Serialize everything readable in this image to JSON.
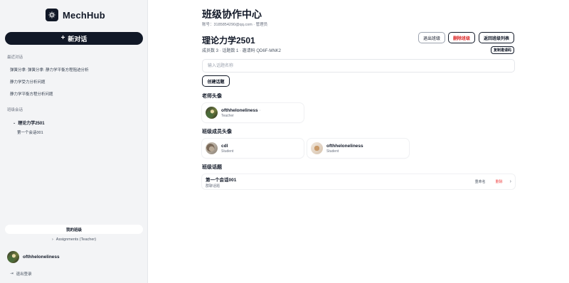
{
  "app": {
    "name": "MechHub"
  },
  "sidebar": {
    "new_chat_label": "新对话",
    "recent_label": "最近对话",
    "recent_items": [
      {
        "label": "弹簧分拿: 弹簧分拿: 静力学平衡方程阻迹分析"
      },
      {
        "label": "静力学受力分析问题"
      },
      {
        "label": "静力学平衡方程分析问题"
      }
    ],
    "class_session_label": "班级会话",
    "class_tree": {
      "class_name": "理论力学2501",
      "sessions": [
        {
          "label": "第一个会话001"
        }
      ]
    },
    "my_class_label": "我的班级",
    "assignments_label": "Assignments (Teacher)",
    "user": {
      "name": "ofthheloneliness"
    },
    "logout_label": "退出登录"
  },
  "main": {
    "page_title": "班级协作中心",
    "account_info": "账号：3185854290@qq.com · 管理员",
    "class": {
      "name": "理论力学2501",
      "meta": "成员数 3 · 话题数 1 · 邀请码 QD6F-MNK2"
    },
    "buttons": {
      "exit": "退出班级",
      "delete": "删除班级",
      "back": "返回班级列表",
      "copy_invite": "复制邀请码",
      "create_topic": "创建话题"
    },
    "topic_input_placeholder": "输入话题名称",
    "teacher_section": "老师头像",
    "teacher": {
      "name": "ofthheloneliness",
      "dot": "·",
      "role": "Teacher"
    },
    "members_section": "班级成员头像",
    "members": [
      {
        "name": "cdl",
        "role": "Student"
      },
      {
        "name": "ofthheloneliness",
        "role": "Student"
      }
    ],
    "topics_section": "班级话题",
    "topics": [
      {
        "name": "第一个会话001",
        "sub": "群聊话题",
        "rename": "重命名",
        "delete": "删除"
      }
    ]
  }
}
